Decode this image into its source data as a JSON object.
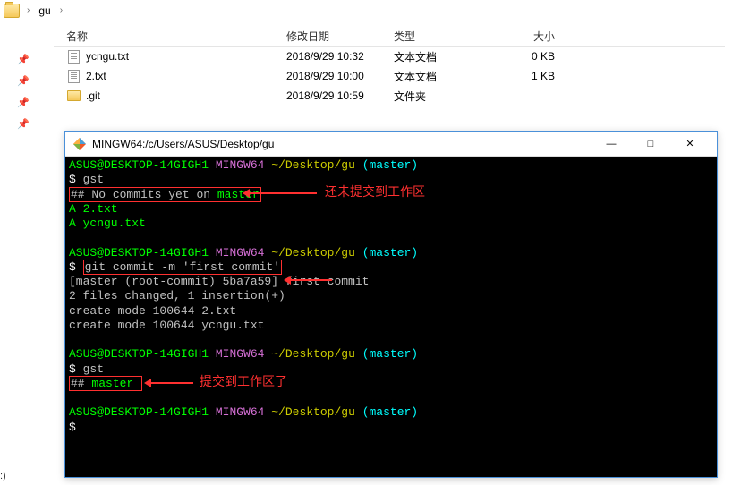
{
  "breadcrumb": {
    "folder": "gu"
  },
  "columns": {
    "name": "名称",
    "date": "修改日期",
    "type": "类型",
    "size": "大小"
  },
  "files": [
    {
      "name": "ycngu.txt",
      "date": "2018/9/29 10:32",
      "type": "文本文档",
      "size": "0 KB",
      "icon": "txt"
    },
    {
      "name": "2.txt",
      "date": "2018/9/29 10:00",
      "type": "文本文档",
      "size": "1 KB",
      "icon": "txt"
    },
    {
      "name": ".git",
      "date": "2018/9/29 10:59",
      "type": "文件夹",
      "size": "",
      "icon": "folder"
    }
  ],
  "terminal": {
    "title": "MINGW64:/c/Users/ASUS/Desktop/gu",
    "prompt": {
      "user": "ASUS@DESKTOP-14GIGH1",
      "env": "MINGW64",
      "path": "~/Desktop/gu",
      "branch": "(master)"
    },
    "block1": {
      "cmd": "gst",
      "status_hash": "##",
      "status_text1": "No commits yet on ",
      "status_branch": "master",
      "line_a1": "A  2.txt",
      "line_a2": "A  ycngu.txt"
    },
    "block2": {
      "cmd": "git commit -m 'first commit'",
      "out1": "[master (root-commit) 5ba7a59] first commit",
      "out2": " 2 files changed, 1 insertion(+)",
      "out3": " create mode 100644 2.txt",
      "out4": " create mode 100644 ycngu.txt"
    },
    "block3": {
      "cmd": "gst",
      "status_hash": "##",
      "status_branch": "master"
    }
  },
  "annotations": {
    "a1": "还未提交到工作区",
    "a2": "提交到工作区了"
  },
  "status_tip": ":)",
  "win_btns": {
    "min": "—",
    "max": "□",
    "close": "✕"
  }
}
